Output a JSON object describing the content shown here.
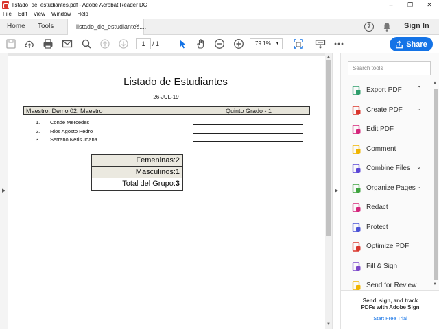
{
  "window": {
    "title": "listado_de_estudiantes.pdf - Adobe Acrobat Reader DC",
    "controls": [
      "–",
      "❐",
      "✕"
    ]
  },
  "menu": [
    "File",
    "Edit",
    "View",
    "Window",
    "Help"
  ],
  "tabs": {
    "home": "Home",
    "tools": "Tools",
    "document": "listado_de_estudiantes....",
    "close": "×",
    "sign_in": "Sign In"
  },
  "toolbar": {
    "page_current": "1",
    "page_total": "/ 1",
    "zoom": "79.1%",
    "share": "Share"
  },
  "document": {
    "title": "Listado de Estudiantes",
    "date": "26-JUL-19",
    "teacher": "Maestro: Demo 02, Maestro",
    "grade": "Quinto Grado - 1",
    "students": [
      {
        "num": "1.",
        "name": "Conde Mercedes"
      },
      {
        "num": "2.",
        "name": "Rios Agosto Pedro"
      },
      {
        "num": "3.",
        "name": "Serrano Neris Joana"
      }
    ],
    "summary": {
      "female": "Femeninas:2",
      "male": "Masculinos:1",
      "total_label": "Total del Grupo:",
      "total_value": "3"
    }
  },
  "tools_pane": {
    "search_placeholder": "Search tools",
    "tools": [
      {
        "label": "Export PDF",
        "icon": "export-pdf-icon",
        "color": "#2d9d6b",
        "chevron": "⌃"
      },
      {
        "label": "Create PDF",
        "icon": "create-pdf-icon",
        "color": "#d9342b",
        "chevron": "⌄"
      },
      {
        "label": "Edit PDF",
        "icon": "edit-pdf-icon",
        "color": "#d4257b",
        "chevron": ""
      },
      {
        "label": "Comment",
        "icon": "comment-icon",
        "color": "#f0b400",
        "chevron": ""
      },
      {
        "label": "Combine Files",
        "icon": "combine-files-icon",
        "color": "#5b47d6",
        "chevron": "⌄"
      },
      {
        "label": "Organize Pages",
        "icon": "organize-pages-icon",
        "color": "#3fa33f",
        "chevron": "⌄"
      },
      {
        "label": "Redact",
        "icon": "redact-icon",
        "color": "#d4257b",
        "chevron": ""
      },
      {
        "label": "Protect",
        "icon": "protect-icon",
        "color": "#4a52d6",
        "chevron": ""
      },
      {
        "label": "Optimize PDF",
        "icon": "optimize-pdf-icon",
        "color": "#d9342b",
        "chevron": ""
      },
      {
        "label": "Fill & Sign",
        "icon": "fill-sign-icon",
        "color": "#7b45c9",
        "chevron": ""
      },
      {
        "label": "Send for Review",
        "icon": "send-review-icon",
        "color": "#f0b400",
        "chevron": ""
      }
    ],
    "promo_line1": "Send, sign, and track",
    "promo_line2": "PDFs with Adobe Sign",
    "promo_link": "Start Free Trial"
  }
}
